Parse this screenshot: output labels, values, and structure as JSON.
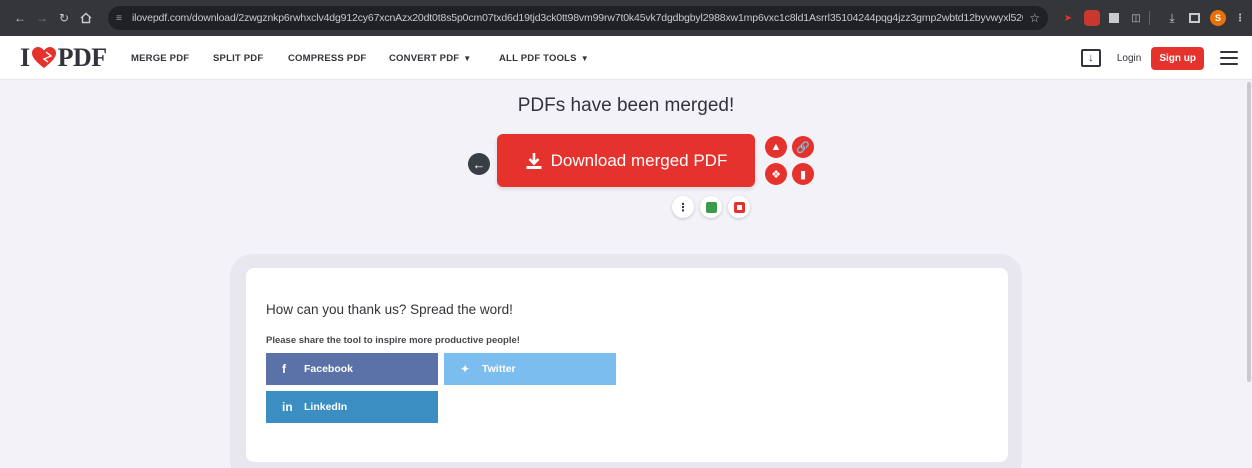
{
  "browser": {
    "url": "ilovepdf.com/download/2zwgznkp6rwhxclv4dg912cy67xcnAzx20dt0t8s5p0cm07txd6d19tjd3ck0tt98vm99rw7t0k45vk7dgdbgbyl2988xw1mp6vxc1c8ld1Asrrl35104244pqg4jzz3gmp2wbtd12byvwyxl52065jk16cAvp34zk4yAA...",
    "profile_initial": "S"
  },
  "header": {
    "logo_left": "I",
    "logo_right": "PDF",
    "menu": [
      {
        "label": "MERGE PDF"
      },
      {
        "label": "SPLIT PDF"
      },
      {
        "label": "COMPRESS PDF"
      },
      {
        "label": "CONVERT PDF"
      },
      {
        "label": "ALL PDF TOOLS"
      }
    ],
    "login": "Login",
    "signup": "Sign up"
  },
  "main": {
    "title": "PDFs have been merged!",
    "download_label": "Download merged PDF"
  },
  "share": {
    "title": "How can you thank us? Spread the word!",
    "subtitle": "Please share the tool to inspire more productive people!",
    "facebook": "Facebook",
    "twitter": "Twitter",
    "linkedin": "LinkedIn"
  },
  "colors": {
    "brand_red": "#e5322d",
    "facebook": "#5a72a8",
    "twitter": "#7cbdf0",
    "linkedin": "#3b8ec2"
  }
}
